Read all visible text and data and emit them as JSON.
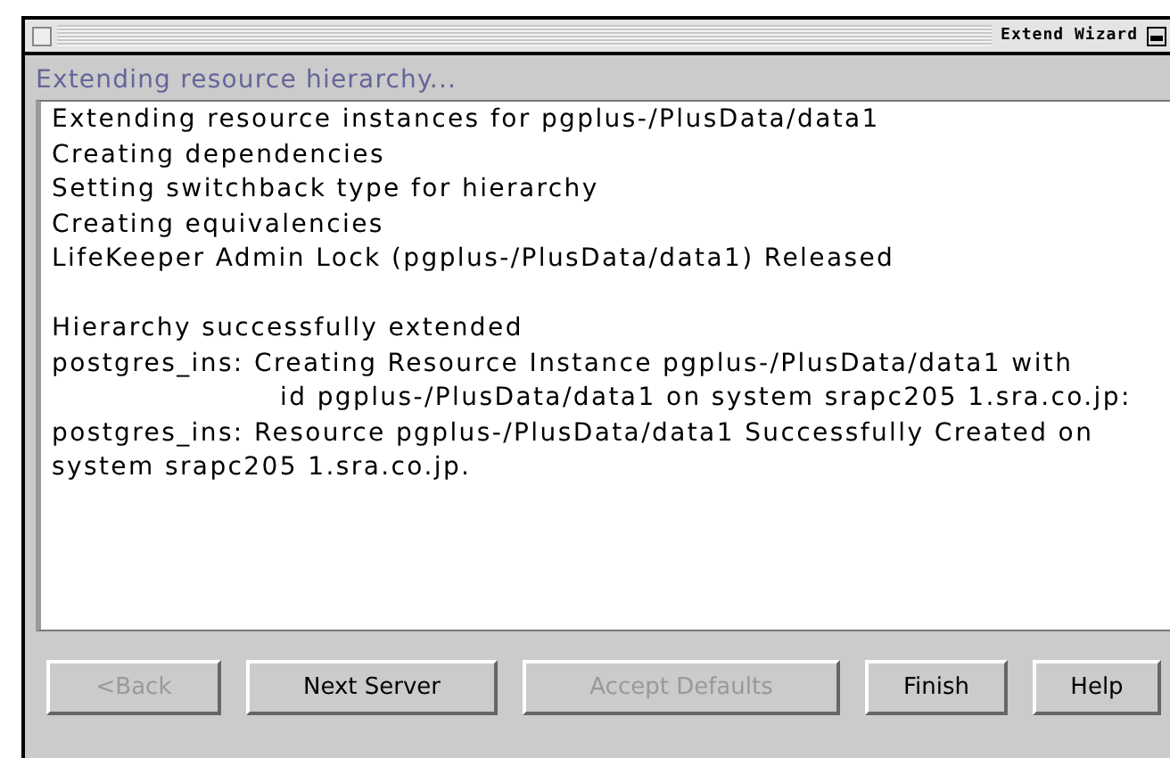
{
  "window": {
    "title": "Extend Wizard"
  },
  "status": "Extending resource hierarchy...",
  "log_blocks": [
    [
      {
        "text": "Extending resource instances for pgplus-/PlusData/data1",
        "indented": false
      },
      {
        "text": "Creating dependencies",
        "indented": false
      },
      {
        "text": "Setting switchback type for hierarchy",
        "indented": false
      },
      {
        "text": "Creating equivalencies",
        "indented": false
      },
      {
        "text": "LifeKeeper Admin Lock (pgplus-/PlusData/data1) Released",
        "indented": false
      }
    ],
    [
      {
        "text": "Hierarchy successfully extended",
        "indented": false
      },
      {
        "text": "postgres_ins: Creating Resource Instance pgplus-/PlusData/data1 with",
        "indented": false
      },
      {
        "text": "id pgplus-/PlusData/data1 on system srapc205 1.sra.co.jp:",
        "indented": true
      },
      {
        "text": "postgres_ins: Resource pgplus-/PlusData/data1 Successfully Created on",
        "indented": false
      },
      {
        "text": "system srapc205 1.sra.co.jp.",
        "indented": false
      }
    ]
  ],
  "buttons": [
    {
      "label": "<Back",
      "disabled": true
    },
    {
      "label": "Next Server",
      "disabled": false
    },
    {
      "label": "Accept Defaults",
      "disabled": true
    },
    {
      "label": "Finish",
      "disabled": false
    },
    {
      "label": "Help",
      "disabled": false
    }
  ]
}
